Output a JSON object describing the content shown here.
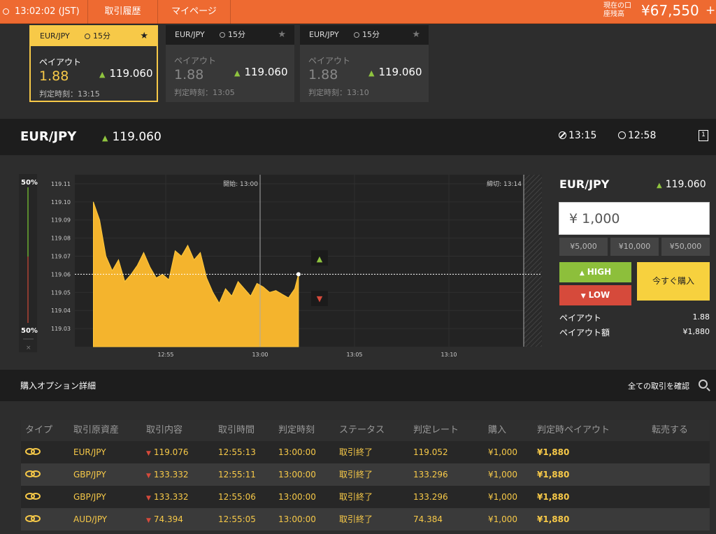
{
  "header": {
    "clock": "13:02:02 (JST)",
    "history_label": "取引履歴",
    "mypage_label": "マイページ",
    "balance_label": "現在の口座残高",
    "balance_value": "¥67,550"
  },
  "cards": [
    {
      "pair": "EUR/JPY",
      "duration": "15分",
      "payout_label": "ペイアウト",
      "payout": "1.88",
      "rate": "119.060",
      "expiry": "判定時刻：13:15"
    },
    {
      "pair": "EUR/JPY",
      "duration": "15分",
      "payout_label": "ペイアウト",
      "payout": "1.88",
      "rate": "119.060",
      "expiry": "判定時刻：13:05"
    },
    {
      "pair": "EUR/JPY",
      "duration": "15分",
      "payout_label": "ペイアウト",
      "payout": "1.88",
      "rate": "119.060",
      "expiry": "判定時刻：13:10"
    }
  ],
  "asset": {
    "pair": "EUR/JPY",
    "rate": "119.060",
    "close_time": "13:15",
    "remaining": "12:58",
    "page_icon": "1"
  },
  "chart_data": {
    "type": "area",
    "pair": "EUR/JPY",
    "y_ticks": [
      "119.11",
      "119.10",
      "119.09",
      "119.08",
      "119.07",
      "119.06",
      "119.05",
      "119.04",
      "119.03"
    ],
    "x_ticks": [
      "12:55",
      "13:00",
      "13:05",
      "13:10"
    ],
    "start_label": "開始: 13:00",
    "end_label": "締切: 13:14",
    "sentiment_top": "50%",
    "sentiment_bottom": "50%",
    "current_rate": 119.06,
    "ylim": [
      119.02,
      119.115
    ],
    "series": [
      {
        "time": "12:51:10",
        "value": 119.1
      },
      {
        "time": "12:51:30",
        "value": 119.09
      },
      {
        "time": "12:51:50",
        "value": 119.07
      },
      {
        "time": "12:52:10",
        "value": 119.062
      },
      {
        "time": "12:52:30",
        "value": 119.068
      },
      {
        "time": "12:52:50",
        "value": 119.056
      },
      {
        "time": "12:53:10",
        "value": 119.06
      },
      {
        "time": "12:53:30",
        "value": 119.065
      },
      {
        "time": "12:53:50",
        "value": 119.072
      },
      {
        "time": "12:54:10",
        "value": 119.064
      },
      {
        "time": "12:54:30",
        "value": 119.058
      },
      {
        "time": "12:54:50",
        "value": 119.06
      },
      {
        "time": "12:55:10",
        "value": 119.057
      },
      {
        "time": "12:55:30",
        "value": 119.073
      },
      {
        "time": "12:55:50",
        "value": 119.07
      },
      {
        "time": "12:56:10",
        "value": 119.076
      },
      {
        "time": "12:56:30",
        "value": 119.068
      },
      {
        "time": "12:56:50",
        "value": 119.072
      },
      {
        "time": "12:57:10",
        "value": 119.058
      },
      {
        "time": "12:57:30",
        "value": 119.05
      },
      {
        "time": "12:57:50",
        "value": 119.044
      },
      {
        "time": "12:58:10",
        "value": 119.052
      },
      {
        "time": "12:58:30",
        "value": 119.048
      },
      {
        "time": "12:58:50",
        "value": 119.056
      },
      {
        "time": "12:59:10",
        "value": 119.052
      },
      {
        "time": "12:59:30",
        "value": 119.048
      },
      {
        "time": "12:59:50",
        "value": 119.055
      },
      {
        "time": "13:00:10",
        "value": 119.053
      },
      {
        "time": "13:00:30",
        "value": 119.05
      },
      {
        "time": "13:00:50",
        "value": 119.051
      },
      {
        "time": "13:01:10",
        "value": 119.049
      },
      {
        "time": "13:01:30",
        "value": 119.047
      },
      {
        "time": "13:01:50",
        "value": 119.052
      },
      {
        "time": "13:02:02",
        "value": 119.06
      }
    ]
  },
  "trade_panel": {
    "pair": "EUR/JPY",
    "rate": "119.060",
    "amount": "¥ 1,000",
    "quick_amounts": [
      "¥5,000",
      "¥10,000",
      "¥50,000"
    ],
    "high_label": "HIGH",
    "low_label": "LOW",
    "buy_label": "今すぐ購入",
    "payout_label": "ペイアウト",
    "payout_value": "1.88",
    "payout_amount_label": "ペイアウト額",
    "payout_amount_value": "¥1,880"
  },
  "details": {
    "title": "購入オプション詳細",
    "see_all": "全ての取引を確認",
    "columns": [
      "タイプ",
      "取引原資産",
      "取引内容",
      "取引時間",
      "判定時刻",
      "ステータス",
      "判定レート",
      "購入",
      "判定時ペイアウト",
      "転売する"
    ],
    "rows": [
      {
        "asset": "EUR/JPY",
        "entry": "119.076",
        "time": "12:55:13",
        "expiry": "13:00:00",
        "status": "取引終了",
        "close_rate": "119.052",
        "amount": "¥1,000",
        "payout": "¥1,880"
      },
      {
        "asset": "GBP/JPY",
        "entry": "133.332",
        "time": "12:55:11",
        "expiry": "13:00:00",
        "status": "取引終了",
        "close_rate": "133.296",
        "amount": "¥1,000",
        "payout": "¥1,880"
      },
      {
        "asset": "GBP/JPY",
        "entry": "133.332",
        "time": "12:55:06",
        "expiry": "13:00:00",
        "status": "取引終了",
        "close_rate": "133.296",
        "amount": "¥1,000",
        "payout": "¥1,880"
      },
      {
        "asset": "AUD/JPY",
        "entry": "74.394",
        "time": "12:55:05",
        "expiry": "13:00:00",
        "status": "取引終了",
        "close_rate": "74.384",
        "amount": "¥1,000",
        "payout": "¥1,880"
      }
    ]
  }
}
